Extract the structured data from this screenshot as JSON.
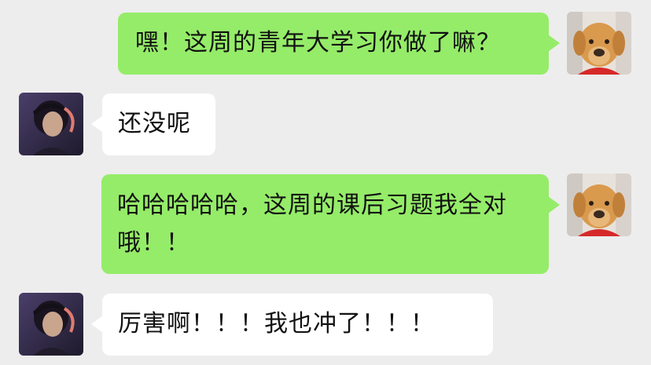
{
  "messages": [
    {
      "sender": "self",
      "avatar": "dog-avatar",
      "text": "嘿！这周的青年大学习你做了嘛？"
    },
    {
      "sender": "friend",
      "avatar": "girl-avatar",
      "text": "还没呢"
    },
    {
      "sender": "self",
      "avatar": "dog-avatar",
      "text": "哈哈哈哈哈，这周的课后习题我全对哦！！"
    },
    {
      "sender": "friend",
      "avatar": "girl-avatar",
      "text": "厉害啊！！！我也冲了！！！"
    }
  ],
  "colors": {
    "background": "#ededed",
    "outgoing_bubble": "#95ec69",
    "incoming_bubble": "#ffffff"
  }
}
